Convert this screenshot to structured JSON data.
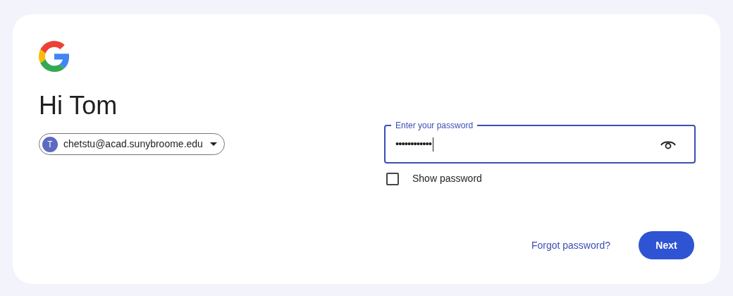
{
  "greeting": "Hi Tom",
  "account": {
    "avatar_letter": "T",
    "email": "chetstu@acad.sunybroome.edu"
  },
  "password_field": {
    "label": "Enter your password",
    "value": "••••••••••••",
    "focused": true
  },
  "show_password": {
    "label": "Show password",
    "checked": false
  },
  "forgot_link": "Forgot password?",
  "next_button": "Next"
}
